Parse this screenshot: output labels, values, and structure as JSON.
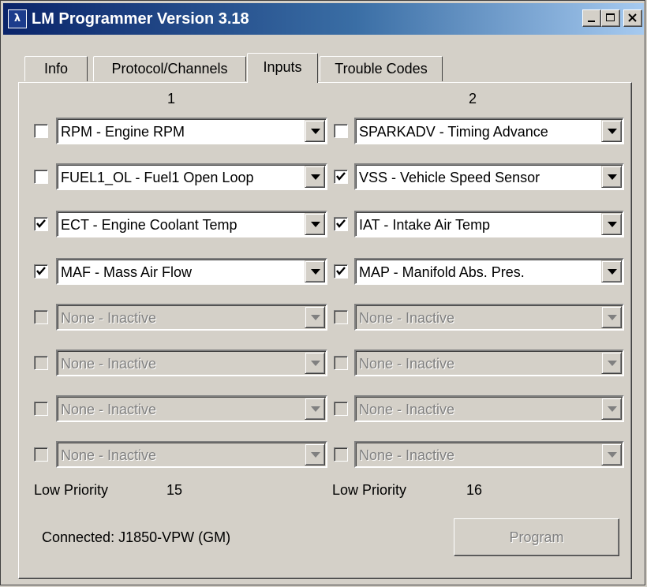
{
  "window": {
    "title": "LM Programmer Version 3.18",
    "icon": "lm-app-icon"
  },
  "tabs": [
    {
      "label": "Info",
      "active": false
    },
    {
      "label": "Protocol/Channels",
      "active": false
    },
    {
      "label": "Inputs",
      "active": true
    },
    {
      "label": "Trouble Codes",
      "active": false
    }
  ],
  "columns": [
    {
      "header": "1",
      "rows": [
        {
          "checked": false,
          "enabled": true,
          "value": "RPM - Engine RPM"
        },
        {
          "checked": false,
          "enabled": true,
          "value": "FUEL1_OL - Fuel1 Open Loop"
        },
        {
          "checked": true,
          "enabled": true,
          "value": "ECT - Engine Coolant Temp"
        },
        {
          "checked": true,
          "enabled": true,
          "value": "MAF - Mass Air Flow"
        },
        {
          "checked": false,
          "enabled": false,
          "value": "None - Inactive"
        },
        {
          "checked": false,
          "enabled": false,
          "value": "None - Inactive"
        },
        {
          "checked": false,
          "enabled": false,
          "value": "None - Inactive"
        },
        {
          "checked": false,
          "enabled": false,
          "value": "None - Inactive"
        }
      ],
      "priority_label": "Low Priority",
      "priority_value": "15"
    },
    {
      "header": "2",
      "rows": [
        {
          "checked": false,
          "enabled": true,
          "value": "SPARKADV - Timing Advance"
        },
        {
          "checked": true,
          "enabled": true,
          "value": "VSS - Vehicle Speed Sensor"
        },
        {
          "checked": true,
          "enabled": true,
          "value": "IAT - Intake Air Temp"
        },
        {
          "checked": true,
          "enabled": true,
          "value": "MAP - Manifold Abs. Pres."
        },
        {
          "checked": false,
          "enabled": false,
          "value": "None - Inactive"
        },
        {
          "checked": false,
          "enabled": false,
          "value": "None - Inactive"
        },
        {
          "checked": false,
          "enabled": false,
          "value": "None - Inactive"
        },
        {
          "checked": false,
          "enabled": false,
          "value": "None - Inactive"
        }
      ],
      "priority_label": "Low Priority",
      "priority_value": "16"
    }
  ],
  "status": {
    "connection": "Connected: J1850-VPW (GM)"
  },
  "program_button": {
    "label": "Program",
    "enabled": false
  },
  "colors": {
    "face": "#d4d0c8",
    "title_start": "#0a246a",
    "title_end": "#a6caf0",
    "disabled_text": "#808080"
  }
}
